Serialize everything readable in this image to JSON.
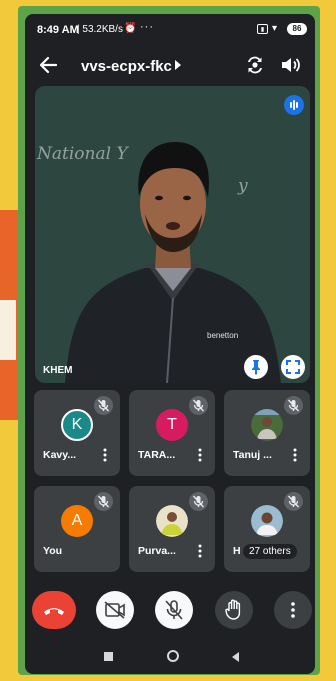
{
  "status_bar": {
    "time": "8:49 AM",
    "network_speed": "| 53.2KB/s",
    "more": "···",
    "battery": "86"
  },
  "top_bar": {
    "meeting_code": "vvs-ecpx-fkc"
  },
  "main_tile": {
    "participant_name": "KHEM",
    "board_text_1": "National Y",
    "board_text_2": "y"
  },
  "participants": [
    {
      "name": "Kavy...",
      "avatar_letter": "K",
      "avatar_color": "#1a8a88",
      "muted": true
    },
    {
      "name": "TARA...",
      "avatar_letter": "T",
      "avatar_color": "#d81b60",
      "muted": true
    },
    {
      "name": "Tanuj ...",
      "avatar_letter": "",
      "avatar_color": "#4a6b3a",
      "muted": true
    },
    {
      "name": "You",
      "avatar_letter": "A",
      "avatar_color": "#f57c00",
      "muted": true
    },
    {
      "name": "Purva...",
      "avatar_letter": "",
      "avatar_color": "#d9c58a",
      "muted": true
    },
    {
      "name": "H",
      "avatar_letter": "",
      "avatar_color": "#9bbcd0",
      "muted": true
    }
  ],
  "others_pill": "27 others",
  "controls": {
    "end_call_color": "#ea4335",
    "camera": "off",
    "microphone": "muted"
  },
  "colors": {
    "background_yellow": "#f2c93a",
    "frame_green": "#5da34a",
    "meet_blue": "#1a73e8"
  },
  "icons": [
    "back-arrow-icon",
    "caret-right-icon",
    "switch-camera-icon",
    "speaker-icon",
    "speaking-indicator-icon",
    "pin-icon",
    "fullscreen-icon",
    "mic-off-icon",
    "more-vert-icon",
    "end-call-icon",
    "camera-off-icon",
    "raise-hand-icon"
  ]
}
